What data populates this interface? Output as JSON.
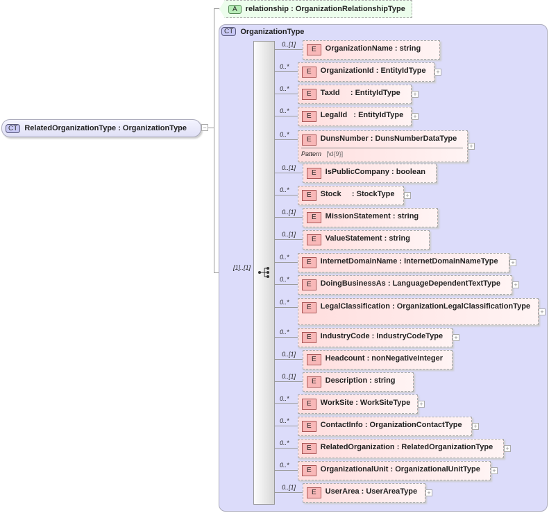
{
  "root": {
    "badge": "CT",
    "label": "RelatedOrganizationType : OrganizationType"
  },
  "attribute": {
    "badge": "A",
    "label": "relationship : OrganizationRelationshipType"
  },
  "complex_type": {
    "badge": "CT",
    "label": "OrganizationType"
  },
  "sequence": {
    "multiplicity": "[1]..[1]"
  },
  "elements": [
    {
      "name": "OrganizationName : string",
      "mult": "0..[1]",
      "expandable": false
    },
    {
      "name": "OrganizationId : EntityIdType",
      "mult": "0..*",
      "expandable": true
    },
    {
      "name": "TaxId     : EntityIdType",
      "mult": "0..*",
      "expandable": true
    },
    {
      "name": "LegalId   : EntityIdType",
      "mult": "0..*",
      "expandable": true
    },
    {
      "name": "DunsNumber : DunsNumberDataType",
      "mult": "0..*",
      "expandable": true,
      "facet_label": "Pattern",
      "facet_value": "[\\d{9}]"
    },
    {
      "name": "IsPublicCompany : boolean",
      "mult": "0..[1]",
      "expandable": false
    },
    {
      "name": "Stock     : StockType",
      "mult": "0..*",
      "expandable": true
    },
    {
      "name": "MissionStatement : string",
      "mult": "0..[1]",
      "expandable": false
    },
    {
      "name": "ValueStatement : string",
      "mult": "0..[1]",
      "expandable": false
    },
    {
      "name": "InternetDomainName : InternetDomainNameType",
      "mult": "0..*",
      "expandable": true
    },
    {
      "name": "DoingBusinessAs : LanguageDependentTextType",
      "mult": "0..*",
      "expandable": true
    },
    {
      "name": "LegalClassification : OrganizationLegalClassificationType",
      "mult": "0..*",
      "expandable": true
    },
    {
      "name": "IndustryCode : IndustryCodeType",
      "mult": "0..*",
      "expandable": true
    },
    {
      "name": "Headcount : nonNegativeInteger",
      "mult": "0..[1]",
      "expandable": false
    },
    {
      "name": "Description : string",
      "mult": "0..[1]",
      "expandable": false
    },
    {
      "name": "WorkSite : WorkSiteType",
      "mult": "0..*",
      "expandable": true
    },
    {
      "name": "ContactInfo : OrganizationContactType",
      "mult": "0..*",
      "expandable": true
    },
    {
      "name": "RelatedOrganization : RelatedOrganizationType",
      "mult": "0..*",
      "expandable": true
    },
    {
      "name": "OrganizationalUnit : OrganizationalUnitType",
      "mult": "0..*",
      "expandable": true
    },
    {
      "name": "UserArea : UserAreaType",
      "mult": "0..[1]",
      "expandable": true
    }
  ],
  "element_badge": "E",
  "expand_glyph": "+",
  "collapse_glyph": "−"
}
